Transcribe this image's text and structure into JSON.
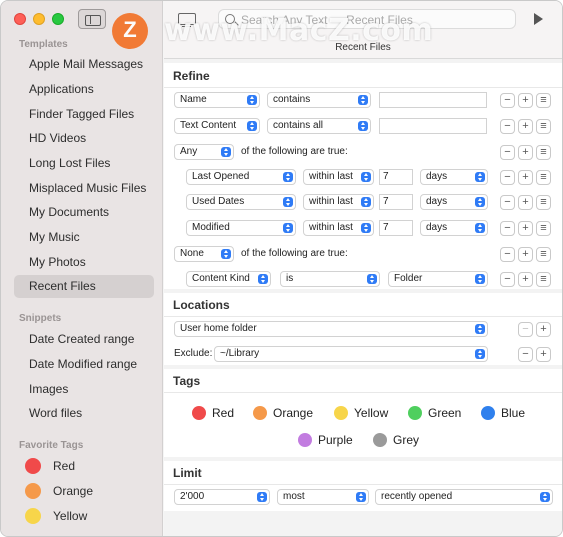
{
  "window": {
    "title": "Recent Files"
  },
  "search": {
    "placeholder": "Search Any Text — Recent Files"
  },
  "watermark": {
    "logo_letter": "Z",
    "text": "www.MacZ.com"
  },
  "sidebar": {
    "templates_title": "Templates",
    "templates": [
      "Apple Mail Messages",
      "Applications",
      "Finder Tagged Files",
      "HD Videos",
      "Long Lost Files",
      "Misplaced Music Files",
      "My Documents",
      "My Music",
      "My Photos",
      "Recent Files"
    ],
    "selected_template": "Recent Files",
    "snippets_title": "Snippets",
    "snippets": [
      "Date Created range",
      "Date Modified range",
      "Images",
      "Word files"
    ],
    "favorite_tags_title": "Favorite Tags",
    "favorite_tags": [
      {
        "label": "Red",
        "color": "#f04a4a"
      },
      {
        "label": "Orange",
        "color": "#f5994a"
      },
      {
        "label": "Yellow",
        "color": "#f7d54a"
      }
    ]
  },
  "refine": {
    "title": "Refine",
    "rows": [
      {
        "field": "Name",
        "op": "contains",
        "value": ""
      },
      {
        "field": "Text Content",
        "op": "contains all",
        "value": ""
      },
      {
        "group": "Any",
        "group_text": "of the following are true:"
      },
      {
        "field": "Last Opened",
        "op": "within last",
        "value": "7",
        "unit": "days"
      },
      {
        "field": "Used Dates",
        "op": "within last",
        "value": "7",
        "unit": "days"
      },
      {
        "field": "Modified",
        "op": "within last",
        "value": "7",
        "unit": "days"
      },
      {
        "group": "None",
        "group_text": "of the following are true:"
      },
      {
        "field": "Content Kind",
        "op": "is",
        "value": "Folder"
      }
    ],
    "minus": "−",
    "plus": "+",
    "more": "≡"
  },
  "locations": {
    "title": "Locations",
    "location": "User home folder",
    "exclude_label": "Exclude:",
    "exclude_value": "~/Library"
  },
  "tags": {
    "title": "Tags",
    "items": [
      {
        "label": "Red",
        "color": "#f04a4a"
      },
      {
        "label": "Orange",
        "color": "#f5994a"
      },
      {
        "label": "Yellow",
        "color": "#f7d54a"
      },
      {
        "label": "Green",
        "color": "#4fcf5e"
      },
      {
        "label": "Blue",
        "color": "#2f80ed"
      },
      {
        "label": "Purple",
        "color": "#c27ce0"
      },
      {
        "label": "Grey",
        "color": "#9a9a9a"
      }
    ]
  },
  "limit": {
    "title": "Limit",
    "count": "2'000",
    "order": "most",
    "sort": "recently opened"
  }
}
